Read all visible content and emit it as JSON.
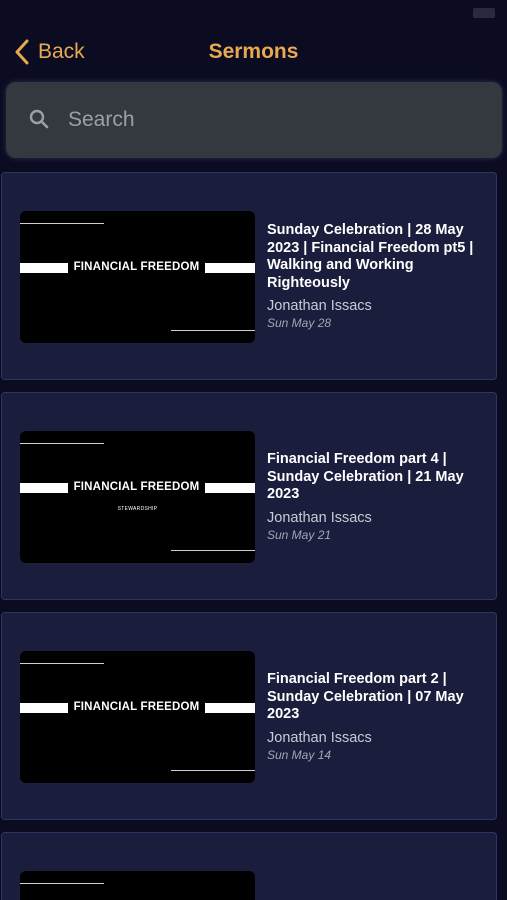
{
  "nav": {
    "back_label": "Back",
    "title": "Sermons"
  },
  "search": {
    "placeholder": "Search",
    "value": ""
  },
  "sermons": [
    {
      "thumbnail_title": "FINANCIAL FREEDOM",
      "thumbnail_subtitle": "",
      "title": "Sunday Celebration | 28 May 2023 | Financial Freedom pt5 | Walking and Working Righteously",
      "author": "Jonathan Issacs",
      "date": "Sun May 28"
    },
    {
      "thumbnail_title": "FINANCIAL FREEDOM",
      "thumbnail_subtitle": "STEWARDSHIP",
      "title": "Financial Freedom part 4 | Sunday Celebration | 21 May 2023",
      "author": "Jonathan Issacs",
      "date": "Sun May 21"
    },
    {
      "thumbnail_title": "FINANCIAL FREEDOM",
      "thumbnail_subtitle": "",
      "title": "Financial Freedom part 2 | Sunday Celebration | 07 May 2023",
      "author": "Jonathan Issacs",
      "date": "Sun May 14"
    }
  ],
  "colors": {
    "accent": "#e8a94f",
    "background": "#0b0b22",
    "card": "#1b1d3c",
    "card_border": "#2e3466"
  },
  "icons": {
    "back": "chevron-left-icon",
    "search": "search-icon"
  }
}
